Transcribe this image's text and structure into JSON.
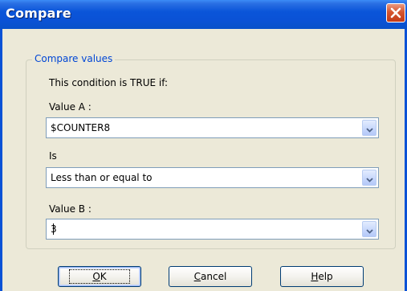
{
  "window": {
    "title": "Compare"
  },
  "group": {
    "legend": "Compare values",
    "condition_text": "This condition is TRUE if:"
  },
  "value_a": {
    "label": "Value A :",
    "value": "$COUNTER8"
  },
  "is": {
    "label": "Is",
    "value": "Less than or equal to"
  },
  "value_b": {
    "label": "Value B :",
    "value": "3"
  },
  "buttons": {
    "ok": {
      "accel": "O",
      "rest": "K"
    },
    "cancel": {
      "accel": "C",
      "rest": "ancel"
    },
    "help": {
      "accel": "H",
      "rest": "elp"
    }
  },
  "icons": {
    "close": "close-icon",
    "dropdown": "chevron-down-icon"
  },
  "colors": {
    "titlebar": "#0a52d6",
    "legend": "#0046d5",
    "close": "#c23a17",
    "face": "#ece9d8"
  }
}
